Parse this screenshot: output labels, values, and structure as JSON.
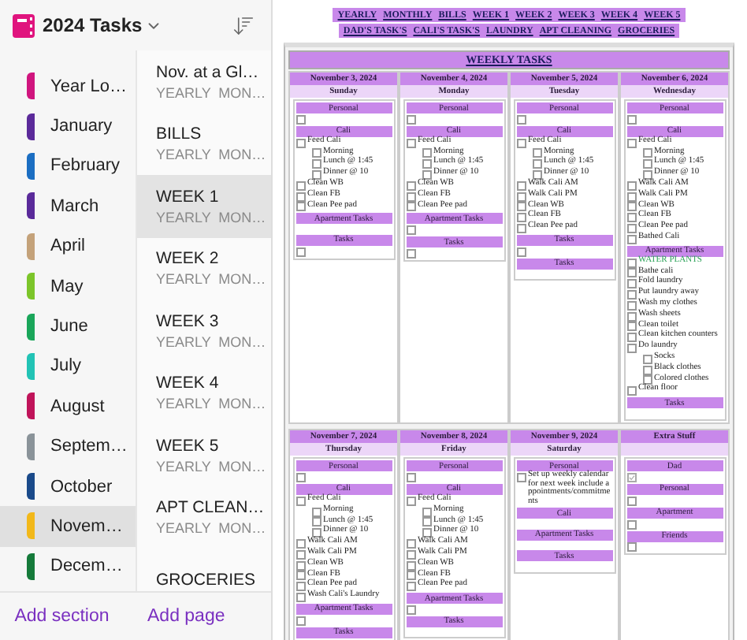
{
  "notebook": {
    "title": "2024 Tasks"
  },
  "sections": [
    {
      "name": "Year Lo…",
      "color": "#d0157e",
      "selected": false
    },
    {
      "name": "January",
      "color": "#5b2a9a",
      "selected": false
    },
    {
      "name": "February",
      "color": "#1b6ec2",
      "selected": false
    },
    {
      "name": "March",
      "color": "#5a2a9a",
      "selected": false
    },
    {
      "name": "April",
      "color": "#c4a27a",
      "selected": false
    },
    {
      "name": "May",
      "color": "#7cc52a",
      "selected": false
    },
    {
      "name": "June",
      "color": "#1aa65a",
      "selected": false
    },
    {
      "name": "July",
      "color": "#22c3b5",
      "selected": false
    },
    {
      "name": "August",
      "color": "#c0145a",
      "selected": false
    },
    {
      "name": "Septem…",
      "color": "#8a9399",
      "selected": false
    },
    {
      "name": "October",
      "color": "#1a4a8a",
      "selected": false
    },
    {
      "name": "Novem…",
      "color": "#f2b81a",
      "selected": true
    },
    {
      "name": "Decem…",
      "color": "#157a3a",
      "selected": false
    }
  ],
  "pages": [
    {
      "title": "Nov. at a Gl…",
      "subtitle": "YEARLY  MON…",
      "selected": false
    },
    {
      "title": "BILLS",
      "subtitle": "YEARLY  MON…",
      "selected": false
    },
    {
      "title": "WEEK 1",
      "subtitle": "YEARLY  MON…",
      "selected": true
    },
    {
      "title": "WEEK 2",
      "subtitle": "YEARLY  MON…",
      "selected": false
    },
    {
      "title": "WEEK 3",
      "subtitle": "YEARLY  MON…",
      "selected": false
    },
    {
      "title": "WEEK 4",
      "subtitle": "YEARLY  MON…",
      "selected": false
    },
    {
      "title": "WEEK 5",
      "subtitle": "YEARLY  MON…",
      "selected": false
    },
    {
      "title": "APT CLEAN…",
      "subtitle": "YEARLY  MON…",
      "selected": false
    },
    {
      "title": "GROCERIES",
      "selected": false
    }
  ],
  "footer": {
    "add_section": "Add section",
    "add_page": "Add page"
  },
  "nav_links": [
    [
      "YEARLY",
      "MONTHLY",
      "BILLS",
      "WEEK 1",
      "WEEK 2",
      "WEEK 3",
      "WEEK 4",
      "WEEK 5"
    ],
    [
      "DAD'S TASK'S",
      "CALI'S TASK'S",
      "LAUNDRY",
      "APT CLEANING",
      "GROCERIES"
    ]
  ],
  "weekly": {
    "title": "WEEKLY TASKS",
    "weeks": [
      [
        {
          "date": "November 3, 2024",
          "day": "Sunday",
          "groups": [
            {
              "title": "Personal",
              "items": [
                {
                  "checked": false
                }
              ]
            },
            {
              "title": "Cali",
              "items": [
                {
                  "text": "Feed Cali",
                  "checked": false,
                  "children": [
                    {
                      "text": "Morning",
                      "checked": false
                    },
                    {
                      "text": "Lunch @ 1:45",
                      "checked": false
                    },
                    {
                      "text": "Dinner @ 10",
                      "checked": false
                    }
                  ]
                },
                {
                  "text": "Clean WB",
                  "checked": false
                },
                {
                  "text": "Clean FB",
                  "checked": false
                },
                {
                  "text": "Clean Pee pad",
                  "checked": false
                }
              ]
            },
            {
              "title": "Apartment Tasks"
            },
            {
              "title": "Tasks",
              "items": [
                {
                  "checked": false
                }
              ]
            }
          ]
        },
        {
          "date": "November 4, 2024",
          "day": "Monday",
          "groups": [
            {
              "title": "Personal",
              "items": [
                {
                  "checked": false
                }
              ]
            },
            {
              "title": "Cali",
              "items": [
                {
                  "text": "Feed Cali",
                  "checked": false,
                  "children": [
                    {
                      "text": "Morning",
                      "checked": false
                    },
                    {
                      "text": "Lunch @ 1:45",
                      "checked": false
                    },
                    {
                      "text": "Dinner @ 10",
                      "checked": false
                    }
                  ]
                },
                {
                  "text": "Clean WB",
                  "checked": false
                },
                {
                  "text": "Clean FB",
                  "checked": false
                },
                {
                  "text": "Clean Pee pad",
                  "checked": false
                }
              ]
            },
            {
              "title": "Apartment Tasks",
              "items": [
                {
                  "checked": false
                }
              ]
            },
            {
              "title": "Tasks",
              "items": [
                {
                  "checked": false
                }
              ]
            }
          ]
        },
        {
          "date": "November 5, 2024",
          "day": "Tuesday",
          "groups": [
            {
              "title": "Personal",
              "items": [
                {
                  "checked": false
                }
              ]
            },
            {
              "title": "Cali",
              "items": [
                {
                  "text": "Feed Cali",
                  "checked": false,
                  "children": [
                    {
                      "text": "Morning",
                      "checked": false
                    },
                    {
                      "text": "Lunch @ 1:45",
                      "checked": false
                    },
                    {
                      "text": "Dinner @ 10",
                      "checked": false
                    }
                  ]
                },
                {
                  "text": "Walk Cali AM",
                  "checked": false
                },
                {
                  "text": "Walk Cali PM",
                  "checked": false
                },
                {
                  "text": "Clean WB",
                  "checked": false
                },
                {
                  "text": "Clean FB",
                  "checked": false
                },
                {
                  "text": "Clean Pee pad",
                  "checked": false
                }
              ]
            },
            {
              "title": "Tasks",
              "items": [
                {
                  "checked": false
                }
              ]
            },
            {
              "title": "Tasks"
            }
          ]
        },
        {
          "date": "November 6, 2024",
          "day": "Wednesday",
          "groups": [
            {
              "title": "Personal",
              "items": [
                {
                  "checked": false
                }
              ]
            },
            {
              "title": "Cali",
              "items": [
                {
                  "text": "Feed Cali",
                  "checked": false,
                  "children": [
                    {
                      "text": "Morning",
                      "checked": false
                    },
                    {
                      "text": "Lunch @ 1:45",
                      "checked": false
                    },
                    {
                      "text": "Dinner @ 10",
                      "checked": false
                    }
                  ]
                },
                {
                  "text": "Walk Cali AM",
                  "checked": false
                },
                {
                  "text": "Walk Cali PM",
                  "checked": false
                },
                {
                  "text": "Clean WB",
                  "checked": false
                },
                {
                  "text": "Clean FB",
                  "checked": false
                },
                {
                  "text": "Clean Pee pad",
                  "checked": false
                },
                {
                  "text": "Bathed Cali",
                  "checked": false
                }
              ]
            },
            {
              "title": "Apartment Tasks",
              "items": [
                {
                  "text": "WATER PLANTS",
                  "checked": false,
                  "color": "#2ea35a"
                },
                {
                  "text": "Bathe cali",
                  "checked": false
                },
                {
                  "text": "Fold laundry",
                  "checked": false
                },
                {
                  "text": "Put laundry away",
                  "checked": false
                },
                {
                  "text": "Wash my clothes",
                  "checked": false
                },
                {
                  "text": "Wash sheets",
                  "checked": false
                },
                {
                  "text": "Clean toilet",
                  "checked": false
                },
                {
                  "text": "Clean kitchen counters",
                  "checked": false
                },
                {
                  "text": "Do laundry",
                  "checked": false,
                  "children": [
                    {
                      "text": "Socks",
                      "checked": false
                    },
                    {
                      "text": "Black clothes",
                      "checked": false
                    },
                    {
                      "text": "Colored clothes",
                      "checked": false
                    }
                  ]
                },
                {
                  "text": "Clean floor",
                  "checked": false
                }
              ]
            },
            {
              "title": "Tasks"
            }
          ]
        }
      ],
      [
        {
          "date": "November 7, 2024",
          "day": "Thursday",
          "groups": [
            {
              "title": "Personal",
              "items": [
                {
                  "checked": false
                }
              ]
            },
            {
              "title": "Cali",
              "items": [
                {
                  "text": "Feed Cali",
                  "checked": false,
                  "children": [
                    {
                      "text": "Morning",
                      "checked": false
                    },
                    {
                      "text": "Lunch @ 1:45",
                      "checked": false
                    },
                    {
                      "text": "Dinner @ 10",
                      "checked": false
                    }
                  ]
                },
                {
                  "text": "Walk Cali AM",
                  "checked": false
                },
                {
                  "text": "Walk Cali PM",
                  "checked": false
                },
                {
                  "text": "Clean WB",
                  "checked": false
                },
                {
                  "text": "Clean FB",
                  "checked": false
                },
                {
                  "text": "Clean Pee pad",
                  "checked": false
                },
                {
                  "text": "Wash Cali's Laundry",
                  "checked": false
                }
              ]
            },
            {
              "title": "Apartment Tasks",
              "items": [
                {
                  "checked": false
                }
              ]
            },
            {
              "title": "Tasks"
            }
          ]
        },
        {
          "date": "November 8, 2024",
          "day": "Friday",
          "groups": [
            {
              "title": "Personal",
              "items": [
                {
                  "checked": false
                }
              ]
            },
            {
              "title": "Cali",
              "items": [
                {
                  "text": "Feed Cali",
                  "checked": false,
                  "children": [
                    {
                      "text": "Morning",
                      "checked": false
                    },
                    {
                      "text": "Lunch @ 1:45",
                      "checked": false
                    },
                    {
                      "text": "Dinner @ 10",
                      "checked": false
                    }
                  ]
                },
                {
                  "text": "Walk Cali AM",
                  "checked": false
                },
                {
                  "text": "Walk Cali PM",
                  "checked": false
                },
                {
                  "text": "Clean WB",
                  "checked": false
                },
                {
                  "text": "Clean FB",
                  "checked": false
                },
                {
                  "text": "Clean Pee pad",
                  "checked": false
                }
              ]
            },
            {
              "title": "Apartment Tasks",
              "items": [
                {
                  "checked": false
                }
              ]
            },
            {
              "title": "Tasks"
            }
          ]
        },
        {
          "date": "November 9, 2024",
          "day": "Saturday",
          "groups": [
            {
              "title": "Personal",
              "items": [
                {
                  "text": "Set up weekly calendar for next week include appointments/commitments",
                  "checked": false
                }
              ]
            },
            {
              "title": "Cali"
            },
            {
              "title": "Apartment Tasks"
            },
            {
              "title": "Tasks"
            }
          ]
        },
        {
          "date": "Extra Stuff",
          "groups": [
            {
              "title": "Dad",
              "items": [
                {
                  "checked": true
                }
              ]
            },
            {
              "title": "Personal",
              "items": [
                {
                  "checked": false
                }
              ]
            },
            {
              "title": "Apartment",
              "items": [
                {
                  "checked": false
                }
              ]
            },
            {
              "title": "Friends",
              "items": [
                {
                  "checked": false
                }
              ]
            }
          ]
        }
      ]
    ]
  }
}
